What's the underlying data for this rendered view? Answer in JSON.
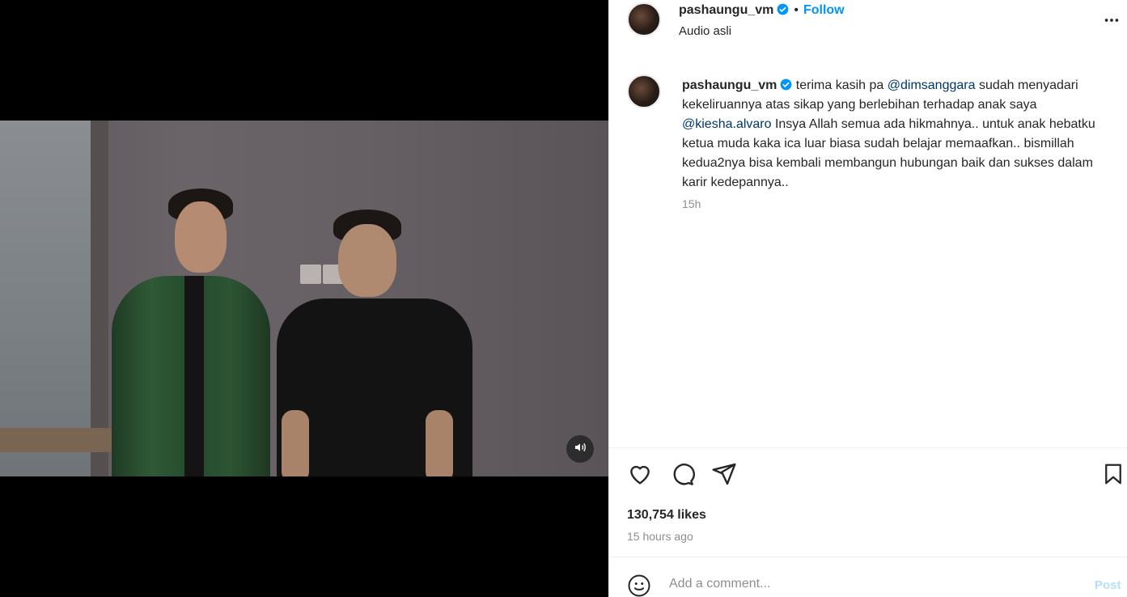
{
  "post": {
    "username": "pashaungu_vm",
    "follow_label": "Follow",
    "separator": "•",
    "audio_label": "Audio asli"
  },
  "caption": {
    "username": "pashaungu_vm",
    "part1": " terima kasih pa ",
    "mention1": "@dimsanggara",
    "part2": " sudah menyadari kekeliruannya atas sikap yang berlebihan terhadap anak saya ",
    "mention2": "@kiesha.alvaro",
    "part3": " Insya Allah semua ada hikmahnya.. untuk anak hebatku ketua muda kaka ica luar biasa sudah belajar memaafkan.. bismillah kedua2nya bisa kembali membangun hubungan baik dan sukses dalam karir kedepannya..",
    "time": "15h"
  },
  "stats": {
    "likes": "130,754 likes",
    "ago": "15 hours ago"
  },
  "comment": {
    "placeholder": "Add a comment...",
    "post_label": "Post"
  },
  "icons": {
    "more": "more-horizontal-icon",
    "like": "heart-icon",
    "comment": "comment-bubble-icon",
    "share": "paper-plane-icon",
    "save": "bookmark-icon",
    "emoji": "smiley-icon",
    "sound": "speaker-icon",
    "verified": "verified-badge-icon"
  },
  "colors": {
    "link_blue": "#0095f6",
    "mention": "#00376b",
    "verified": "#0095f6",
    "muted": "#8e8e8e"
  }
}
